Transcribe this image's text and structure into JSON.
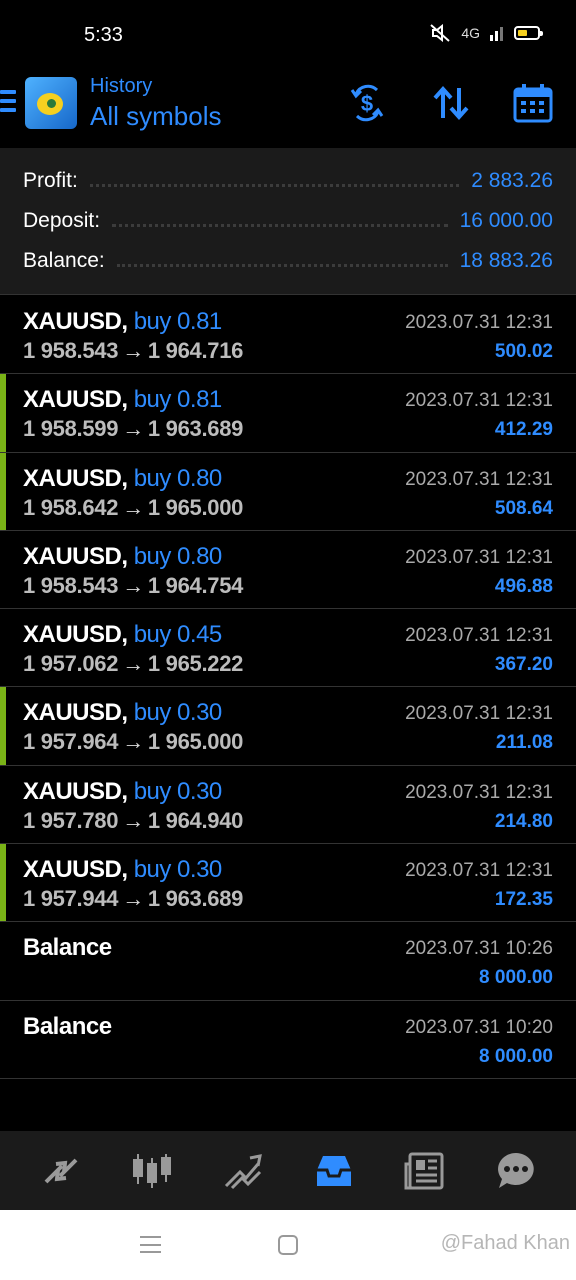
{
  "status_bar": {
    "time": "5:33",
    "network": "4G",
    "icons": [
      "mute-icon",
      "signal-icon",
      "battery-icon"
    ]
  },
  "header": {
    "menu_icon": "menu-icon",
    "subtitle": "History",
    "title": "All symbols",
    "actions": [
      "dollar-refresh-icon",
      "sort-icon",
      "calendar-icon"
    ]
  },
  "summary": {
    "profit_label": "Profit:",
    "profit_value": "2 883.26",
    "deposit_label": "Deposit:",
    "deposit_value": "16 000.00",
    "balance_label": "Balance:",
    "balance_value": "18 883.26"
  },
  "deals": [
    {
      "symbol": "XAUUSD,",
      "type": "buy 0.81",
      "open": "1 958.543",
      "close": "1 964.716",
      "time": "2023.07.31 12:31",
      "profit": "500.02",
      "marked": false
    },
    {
      "symbol": "XAUUSD,",
      "type": "buy 0.81",
      "open": "1 958.599",
      "close": "1 963.689",
      "time": "2023.07.31 12:31",
      "profit": "412.29",
      "marked": true
    },
    {
      "symbol": "XAUUSD,",
      "type": "buy 0.80",
      "open": "1 958.642",
      "close": "1 965.000",
      "time": "2023.07.31 12:31",
      "profit": "508.64",
      "marked": true
    },
    {
      "symbol": "XAUUSD,",
      "type": "buy 0.80",
      "open": "1 958.543",
      "close": "1 964.754",
      "time": "2023.07.31 12:31",
      "profit": "496.88",
      "marked": false
    },
    {
      "symbol": "XAUUSD,",
      "type": "buy 0.45",
      "open": "1 957.062",
      "close": "1 965.222",
      "time": "2023.07.31 12:31",
      "profit": "367.20",
      "marked": false
    },
    {
      "symbol": "XAUUSD,",
      "type": "buy 0.30",
      "open": "1 957.964",
      "close": "1 965.000",
      "time": "2023.07.31 12:31",
      "profit": "211.08",
      "marked": true
    },
    {
      "symbol": "XAUUSD,",
      "type": "buy 0.30",
      "open": "1 957.780",
      "close": "1 964.940",
      "time": "2023.07.31 12:31",
      "profit": "214.80",
      "marked": false
    },
    {
      "symbol": "XAUUSD,",
      "type": "buy 0.30",
      "open": "1 957.944",
      "close": "1 963.689",
      "time": "2023.07.31 12:31",
      "profit": "172.35",
      "marked": true
    },
    {
      "symbol": "Balance",
      "type": "",
      "open": "",
      "close": "",
      "time": "2023.07.31 10:26",
      "profit": "8 000.00",
      "marked": false
    },
    {
      "symbol": "Balance",
      "type": "",
      "open": "",
      "close": "",
      "time": "2023.07.31 10:20",
      "profit": "8 000.00",
      "marked": false
    }
  ],
  "bottom_nav": {
    "items": [
      "quotes-icon",
      "chart-icon",
      "trade-icon",
      "history-icon",
      "news-icon",
      "chat-icon"
    ],
    "active": "history-icon"
  },
  "watermark": "@Fahad Khan",
  "colors": {
    "accent": "#2f8cff",
    "marker": "#7ab317",
    "summary_bg": "#1b1b1b",
    "background": "#000000"
  }
}
